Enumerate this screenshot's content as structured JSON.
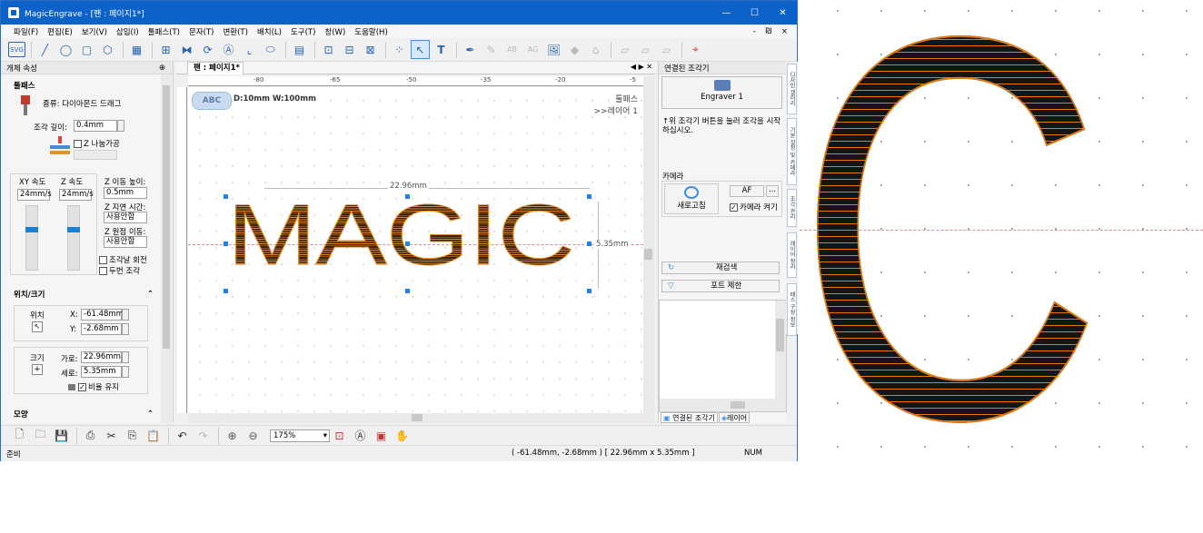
{
  "window": {
    "title": "MagicEngrave - [팬 : 페이지1*]",
    "minimize": "—",
    "maximize": "☐",
    "close": "✕"
  },
  "menu": [
    "파일(F)",
    "편집(E)",
    "보기(V)",
    "삽입(I)",
    "툴패스(T)",
    "문자(T)",
    "변환(T)",
    "배치(L)",
    "도구(T)",
    "창(W)",
    "도움말(H)"
  ],
  "menu_mdi": "- ₪ ×",
  "left_panel": {
    "title": "개체 속성",
    "pin": "⊕",
    "toolpath_section": "툴패스",
    "type_label": "종류: 다이아몬드 드래그",
    "depth_label": "조각 깊이:",
    "depth_value": "0.4mm",
    "z_lift_label": "Z 나눔가공",
    "xy_speed_label": "XY 속도",
    "xy_speed_value": "24mm/s",
    "z_speed_label": "Z 속도",
    "z_speed_value": "24mm/s",
    "z_move_height_label": "Z 이동 높이:",
    "z_move_height_value": "0.5mm",
    "z_delay_label": "Z 지연 시간:",
    "z_delay_value": "사용안함",
    "z_origin_label": "Z 원점 이동:",
    "z_origin_value": "사용안함",
    "rotate_label": "조각날 회전",
    "twice_label": "두번 조각",
    "pos_size_section": "위치/크기",
    "position_label": "위치",
    "x_label": "X:",
    "x_value": "-61.48mm",
    "y_label": "Y:",
    "y_value": "-2.68mm",
    "size_label": "크기",
    "w_label": "가로:",
    "w_value": "22.96mm",
    "h_label": "세로:",
    "h_value": "5.35mm",
    "keep_ratio_label": "비율 유지",
    "shape_section": "모양",
    "collapse": "⌃"
  },
  "doc_tab": {
    "label": "팬 : 페이지1*",
    "nav": "◀ ▶ ✕"
  },
  "ruler": {
    "ticks": [
      "-80",
      "-65",
      "-50",
      "-35",
      "-20",
      "-5"
    ]
  },
  "canvas": {
    "info_badge": "ABC",
    "info_text": "D:10mm   W:100mm",
    "toolpath_label": "툴패스",
    "layer_label": ">>레이어 1",
    "text": "MAGIC",
    "width_dim": "22.96mm",
    "height_dim": "5.35mm"
  },
  "right_panel": {
    "title": "연결된 조각기",
    "engraver_label": "Engraver 1",
    "hint": "↑위 조각기 버튼을 눌러 조각을 시작하십시오.",
    "camera_section": "카메라",
    "refresh_label": "새로고침",
    "af_label": "AF",
    "more_label": "...",
    "camera_off_label": "카메라 켜기",
    "rescan_label": "재검색",
    "port_limit_label": "포트 제한",
    "tab_connected": "연결된 조각기",
    "tab_layer": "레이어"
  },
  "side_tabs": [
    "디자인 갤러리",
    "기본 설정 및 카메라",
    "조각 관리",
    "레이어 정리",
    "패스 구성 정보"
  ],
  "bottom": {
    "zoom_value": "175%"
  },
  "status": {
    "ready": "준비",
    "coords": "( -61.48mm, -2.68mm )  [ 22.96mm x 5.35mm ]",
    "num": "NUM"
  },
  "zoom_view": {
    "letter": "C"
  },
  "colors": {
    "titlebar": "#0c62c9",
    "accent": "#1e82e6",
    "fill_orange": "#e07a12",
    "fill_dark": "#1a1a1a"
  }
}
